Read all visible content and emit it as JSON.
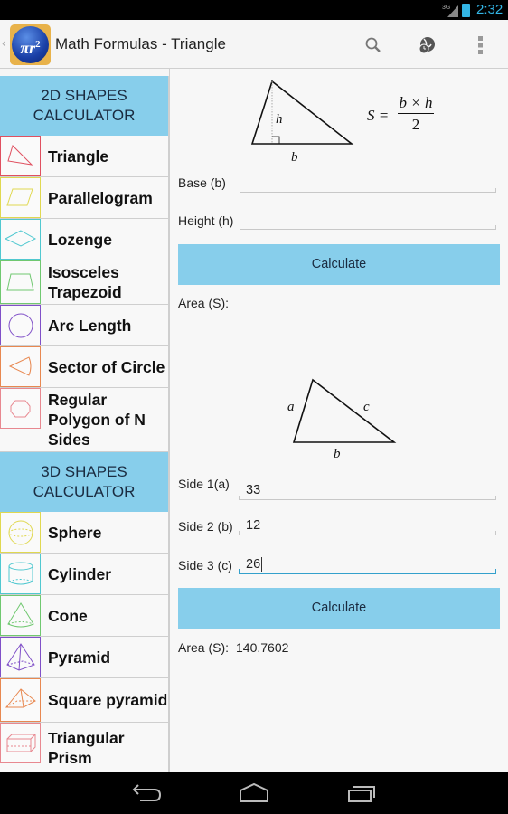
{
  "status_bar": {
    "network": "3G",
    "time": "2:32",
    "accent": "#33b5e5"
  },
  "action_bar": {
    "app_icon_text": "πr",
    "app_icon_sup": "2",
    "title": "Math Formulas - Triangle",
    "actions": [
      "search-icon",
      "globe-clock-icon",
      "overflow-menu-icon"
    ]
  },
  "sidebar": {
    "section_2d": {
      "line1": "2D SHAPES",
      "line2": "CALCULATOR"
    },
    "items_2d": [
      {
        "label": "Triangle",
        "icon": "triangle-icon",
        "color": "#e05060"
      },
      {
        "label": "Parallelogram",
        "icon": "parallelogram-icon",
        "color": "#e0d850"
      },
      {
        "label": "Lozenge",
        "icon": "lozenge-icon",
        "color": "#50c8d0"
      },
      {
        "label": "Isosceles Trapezoid",
        "icon": "trapezoid-icon",
        "color": "#70c870"
      },
      {
        "label": "Arc Length",
        "icon": "circle-icon",
        "color": "#8050c8"
      },
      {
        "label": "Sector of Circle",
        "icon": "sector-icon",
        "color": "#e88850"
      },
      {
        "label": "Regular Polygon of N Sides",
        "icon": "polygon-icon",
        "color": "#e88890"
      }
    ],
    "section_3d": {
      "line1": "3D SHAPES",
      "line2": "CALCULATOR"
    },
    "items_3d": [
      {
        "label": "Sphere",
        "icon": "sphere-icon",
        "color": "#e0d850"
      },
      {
        "label": "Cylinder",
        "icon": "cylinder-icon",
        "color": "#50c8d0"
      },
      {
        "label": "Cone",
        "icon": "cone-icon",
        "color": "#70c870"
      },
      {
        "label": "Pyramid",
        "icon": "pyramid-icon",
        "color": "#8050c8"
      },
      {
        "label": "Square pyramid",
        "icon": "square-pyramid-icon",
        "color": "#e88850"
      },
      {
        "label": "Triangular Prism",
        "icon": "prism-icon",
        "color": "#e88890"
      }
    ],
    "header_color": "#87ceeb"
  },
  "main": {
    "calc1": {
      "diagram": {
        "height_label": "h",
        "base_label": "b"
      },
      "formula": {
        "lhs": "S =",
        "numerator": "b × h",
        "denominator": "2"
      },
      "base_label": "Base (b)",
      "base_value": "",
      "height_label": "Height (h)",
      "height_value": "",
      "button": "Calculate",
      "result_label": "Area (S):",
      "result_value": ""
    },
    "calc2": {
      "diagram": {
        "a": "a",
        "b": "b",
        "c": "c"
      },
      "side1_label": "Side 1(a)",
      "side1_value": "33",
      "side2_label": "Side 2 (b)",
      "side2_value": "12",
      "side3_label": "Side 3 (c)",
      "side3_value": "26",
      "button": "Calculate",
      "result_label": "Area (S):",
      "result_value": "140.7602"
    },
    "button_color": "#87ceeb",
    "focus_color": "#33a0cc"
  }
}
